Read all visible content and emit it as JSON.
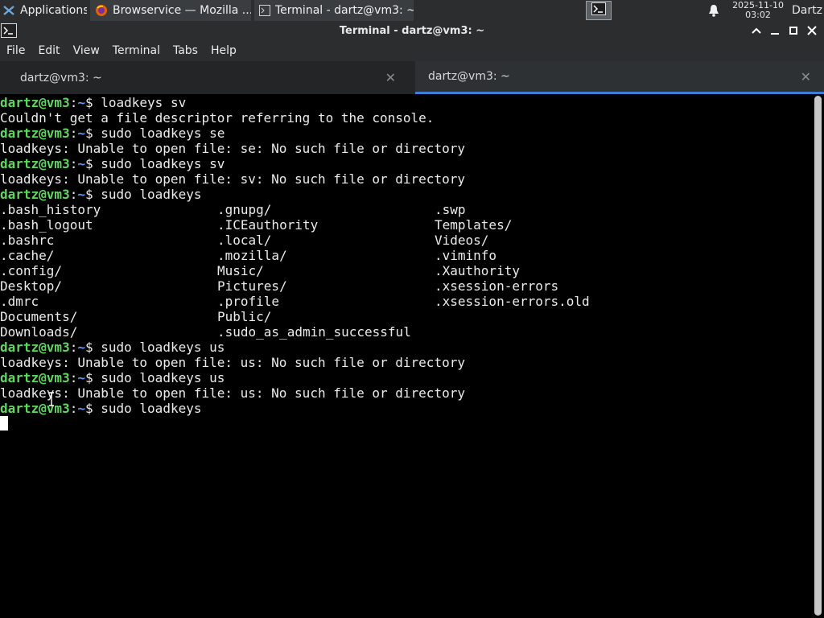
{
  "panel": {
    "apps_label": "Applications ☰",
    "tasks": [
      {
        "label": "Browservice — Mozilla ..."
      },
      {
        "label": "Terminal - dartz@vm3: ~"
      }
    ],
    "clock_date": "2025-11-10",
    "clock_time": "03:02",
    "user": "Dartz"
  },
  "window": {
    "title": "Terminal - dartz@vm3: ~"
  },
  "menu": [
    "File",
    "Edit",
    "View",
    "Terminal",
    "Tabs",
    "Help"
  ],
  "tabs": [
    {
      "label": "dartz@vm3: ~",
      "active": false
    },
    {
      "label": "dartz@vm3: ~",
      "active": true
    }
  ],
  "terminal": {
    "prompt_user": "dartz@vm3",
    "prompt_sep": ":",
    "prompt_dir": "~",
    "prompt_sym": "$ ",
    "cmd1": "loadkeys sv",
    "out1": "Couldn't get a file descriptor referring to the console.",
    "cmd2": "sudo loadkeys se",
    "out2": "loadkeys: Unable to open file: se: No such file or directory",
    "cmd3": "sudo loadkeys sv",
    "out3": "loadkeys: Unable to open file: sv: No such file or directory",
    "cmd4": "sudo loadkeys",
    "listing": [
      [
        ".bash_history",
        ".gnupg/",
        ".swp"
      ],
      [
        ".bash_logout",
        ".ICEauthority",
        "Templates/"
      ],
      [
        ".bashrc",
        ".local/",
        "Videos/"
      ],
      [
        ".cache/",
        ".mozilla/",
        ".viminfo"
      ],
      [
        ".config/",
        "Music/",
        ".Xauthority"
      ],
      [
        "Desktop/",
        "Pictures/",
        ".xsession-errors"
      ],
      [
        ".dmrc",
        ".profile",
        ".xsession-errors.old"
      ],
      [
        "Documents/",
        "Public/",
        ""
      ],
      [
        "Downloads/",
        ".sudo_as_admin_successful",
        ""
      ]
    ],
    "cmd5": "sudo loadkeys us",
    "out5": "loadkeys: Unable to open file: us: No such file or directory",
    "cmd6": "sudo loadkeys us",
    "out6": "loadkeys: Unable to open file: us: No such file or directory",
    "cmd7": "sudo loadkeys"
  }
}
